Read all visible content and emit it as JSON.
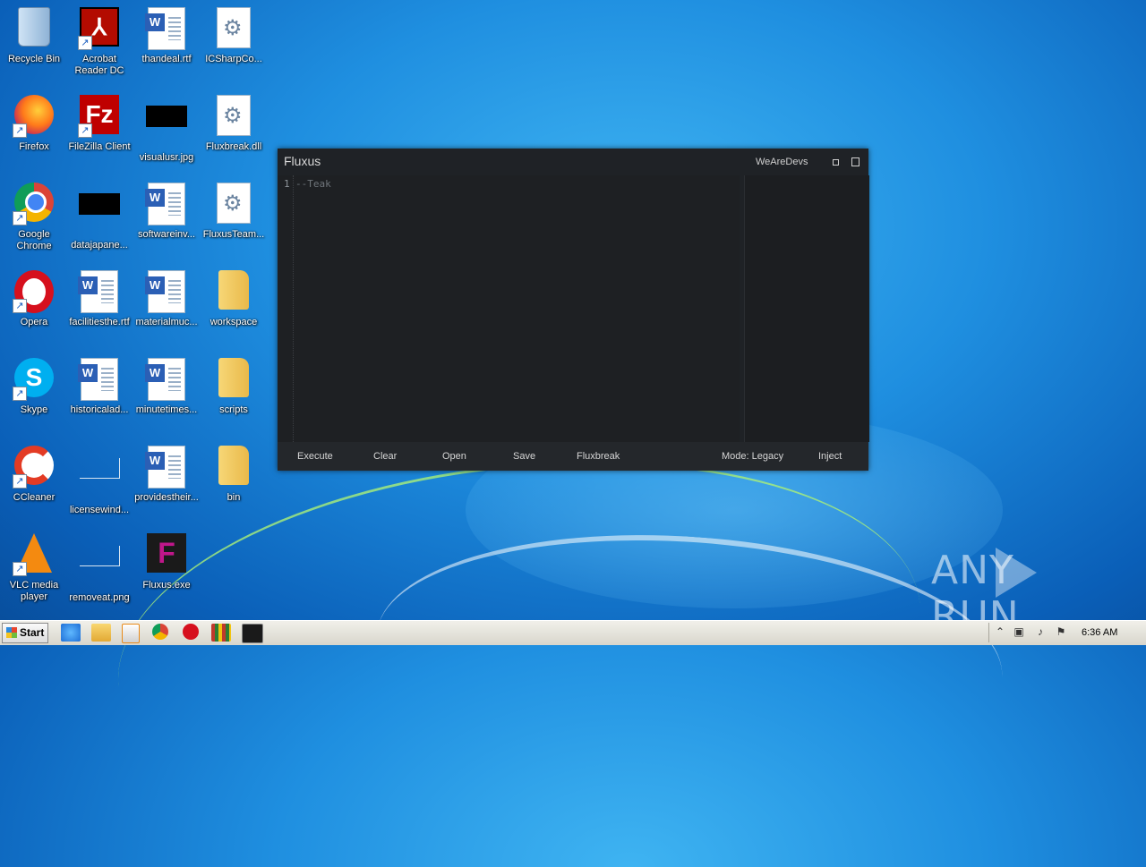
{
  "desktop": {
    "icons": [
      {
        "label": "Recycle Bin"
      },
      {
        "label": "Acrobat\nReader DC"
      },
      {
        "label": "thandeal.rtf"
      },
      {
        "label": "ICSharpCo..."
      },
      {
        "label": "Firefox"
      },
      {
        "label": "FileZilla Client"
      },
      {
        "label": "visualusr.jpg"
      },
      {
        "label": "Fluxbreak.dll"
      },
      {
        "label": "Google\nChrome"
      },
      {
        "label": "datajapane..."
      },
      {
        "label": "softwareinv..."
      },
      {
        "label": "FluxusTeam..."
      },
      {
        "label": "Opera"
      },
      {
        "label": "facilitiesthe.rtf"
      },
      {
        "label": "materialmuc..."
      },
      {
        "label": "workspace"
      },
      {
        "label": "Skype"
      },
      {
        "label": "historicalad..."
      },
      {
        "label": "minutetimes..."
      },
      {
        "label": "scripts"
      },
      {
        "label": "CCleaner"
      },
      {
        "label": "licensewind..."
      },
      {
        "label": "providestheir..."
      },
      {
        "label": "bin"
      },
      {
        "label": "VLC media\nplayer"
      },
      {
        "label": "removeat.png"
      },
      {
        "label": "Fluxus.exe"
      }
    ]
  },
  "fluxus": {
    "title": "Fluxus",
    "brand": "WeAreDevs",
    "line_number": "1",
    "code": "--Teak",
    "buttons": {
      "execute": "Execute",
      "clear": "Clear",
      "open": "Open",
      "save": "Save",
      "fluxbreak": "Fluxbreak",
      "mode": "Mode: Legacy",
      "inject": "Inject"
    }
  },
  "taskbar": {
    "start": "Start",
    "clock": "6:36 AM"
  },
  "watermark": {
    "left": "ANY",
    "right": "RUN"
  },
  "colors": {
    "window_bg": "#1f2226",
    "taskbar": "#d8d6cc",
    "desktop": "#1f8fe0"
  }
}
